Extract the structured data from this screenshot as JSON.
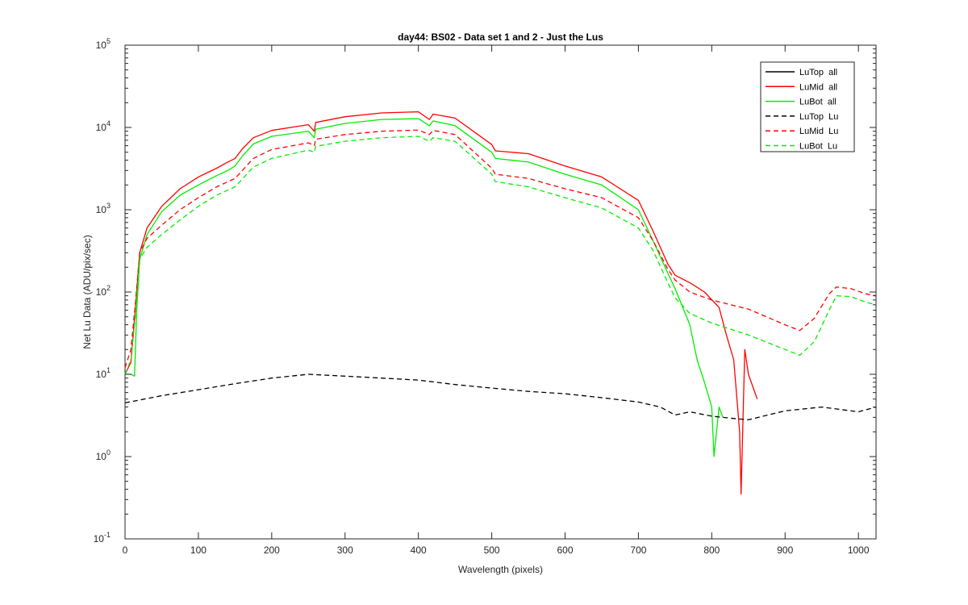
{
  "chart_data": {
    "type": "line",
    "title": "day44: BS02 - Data set 1 and 2 - Just the Lus",
    "xlabel": "Wavelength (pixels)",
    "ylabel": "Net Lu Data (ADU/pix/sec)",
    "xlim": [
      0,
      1024
    ],
    "ylim": [
      0.1,
      100000
    ],
    "yscale": "log",
    "grid": false,
    "legend_position": "top-right",
    "x_ticks": [
      0,
      100,
      200,
      300,
      400,
      500,
      600,
      700,
      800,
      900,
      1000
    ],
    "y_ticks": [
      {
        "base": "10",
        "exp": "-1",
        "value": 0.1
      },
      {
        "base": "10",
        "exp": "0",
        "value": 1
      },
      {
        "base": "10",
        "exp": "1",
        "value": 10
      },
      {
        "base": "10",
        "exp": "2",
        "value": 100
      },
      {
        "base": "10",
        "exp": "3",
        "value": 1000
      },
      {
        "base": "10",
        "exp": "4",
        "value": 10000
      },
      {
        "base": "10",
        "exp": "5",
        "value": 100000
      }
    ],
    "series": [
      {
        "name": "LuTop  all",
        "color": "#000000",
        "style": "solid",
        "x": [],
        "y": []
      },
      {
        "name": "LuMid  all",
        "color": "#ff0000",
        "style": "solid",
        "x": [
          0,
          8,
          14,
          20,
          30,
          50,
          75,
          100,
          125,
          140,
          150,
          160,
          175,
          200,
          250,
          258,
          260,
          300,
          350,
          400,
          415,
          420,
          450,
          500,
          505,
          550,
          600,
          650,
          700,
          720,
          740,
          750,
          770,
          790,
          810,
          820,
          830,
          838,
          840,
          845,
          850,
          862
        ],
        "y": [
          10,
          14,
          60,
          300,
          600,
          1100,
          1800,
          2500,
          3200,
          3800,
          4200,
          5500,
          7500,
          9200,
          10800,
          9000,
          11500,
          13500,
          15000,
          15500,
          12500,
          14500,
          13000,
          6200,
          5200,
          4800,
          3400,
          2500,
          1300,
          550,
          220,
          160,
          130,
          100,
          65,
          30,
          15,
          2,
          0.35,
          20,
          10,
          5
        ]
      },
      {
        "name": "LuBot  all",
        "color": "#00ee00",
        "style": "solid",
        "x": [
          0,
          8,
          13,
          16,
          20,
          30,
          50,
          75,
          100,
          125,
          140,
          150,
          160,
          175,
          200,
          250,
          258,
          260,
          300,
          350,
          400,
          415,
          420,
          450,
          500,
          505,
          550,
          600,
          650,
          700,
          720,
          740,
          750,
          770,
          780,
          790,
          800,
          803,
          810,
          815
        ],
        "y": [
          10,
          10,
          9.5,
          60,
          250,
          500,
          950,
          1500,
          2000,
          2600,
          3000,
          3400,
          4500,
          6300,
          7800,
          9000,
          7500,
          9500,
          11200,
          12500,
          12800,
          10500,
          12000,
          10500,
          5000,
          4200,
          3800,
          2700,
          2000,
          1000,
          420,
          170,
          110,
          40,
          15,
          8,
          4,
          1,
          4,
          3
        ]
      },
      {
        "name": "LuTop  Lu",
        "color": "#000000",
        "style": "dashed",
        "x": [
          0,
          50,
          100,
          150,
          200,
          250,
          300,
          350,
          400,
          450,
          500,
          550,
          600,
          650,
          700,
          730,
          750,
          770,
          800,
          830,
          850,
          900,
          950,
          1000,
          1024
        ],
        "y": [
          4.5,
          5.5,
          6.5,
          7.7,
          9,
          10,
          9.5,
          9,
          8.5,
          7.5,
          6.8,
          6.2,
          5.8,
          5.2,
          4.6,
          4,
          3.2,
          3.5,
          3.1,
          2.9,
          2.8,
          3.6,
          4,
          3.5,
          4
        ]
      },
      {
        "name": "LuMid  Lu",
        "color": "#ff0000",
        "style": "dashed",
        "x": [
          0,
          8,
          14,
          20,
          30,
          50,
          75,
          100,
          125,
          150,
          175,
          200,
          250,
          258,
          260,
          300,
          350,
          400,
          415,
          420,
          450,
          500,
          505,
          550,
          600,
          650,
          700,
          720,
          740,
          750,
          770,
          800,
          850,
          900,
          920,
          940,
          960,
          970,
          990,
          1010,
          1024
        ],
        "y": [
          12,
          20,
          70,
          300,
          450,
          650,
          1000,
          1400,
          1900,
          2400,
          4200,
          5400,
          6500,
          6000,
          7200,
          8200,
          9000,
          9300,
          8200,
          9200,
          8200,
          3200,
          2700,
          2400,
          1800,
          1400,
          800,
          420,
          190,
          140,
          100,
          80,
          62,
          40,
          34,
          48,
          95,
          115,
          110,
          95,
          90
        ]
      },
      {
        "name": "LuBot  Lu",
        "color": "#00ee00",
        "style": "dashed",
        "x": [
          0,
          8,
          14,
          20,
          30,
          50,
          75,
          100,
          125,
          150,
          175,
          200,
          250,
          258,
          260,
          300,
          350,
          400,
          415,
          420,
          450,
          500,
          505,
          550,
          600,
          650,
          700,
          720,
          740,
          750,
          770,
          800,
          850,
          900,
          920,
          940,
          960,
          970,
          990,
          1010,
          1024
        ],
        "y": [
          10,
          15,
          50,
          250,
          350,
          500,
          750,
          1100,
          1500,
          1900,
          3300,
          4200,
          5300,
          5000,
          5900,
          6800,
          7500,
          7800,
          6800,
          7500,
          6800,
          2700,
          2200,
          1900,
          1400,
          1050,
          600,
          320,
          130,
          85,
          55,
          42,
          30,
          20,
          17,
          25,
          60,
          90,
          88,
          75,
          70
        ]
      }
    ]
  }
}
